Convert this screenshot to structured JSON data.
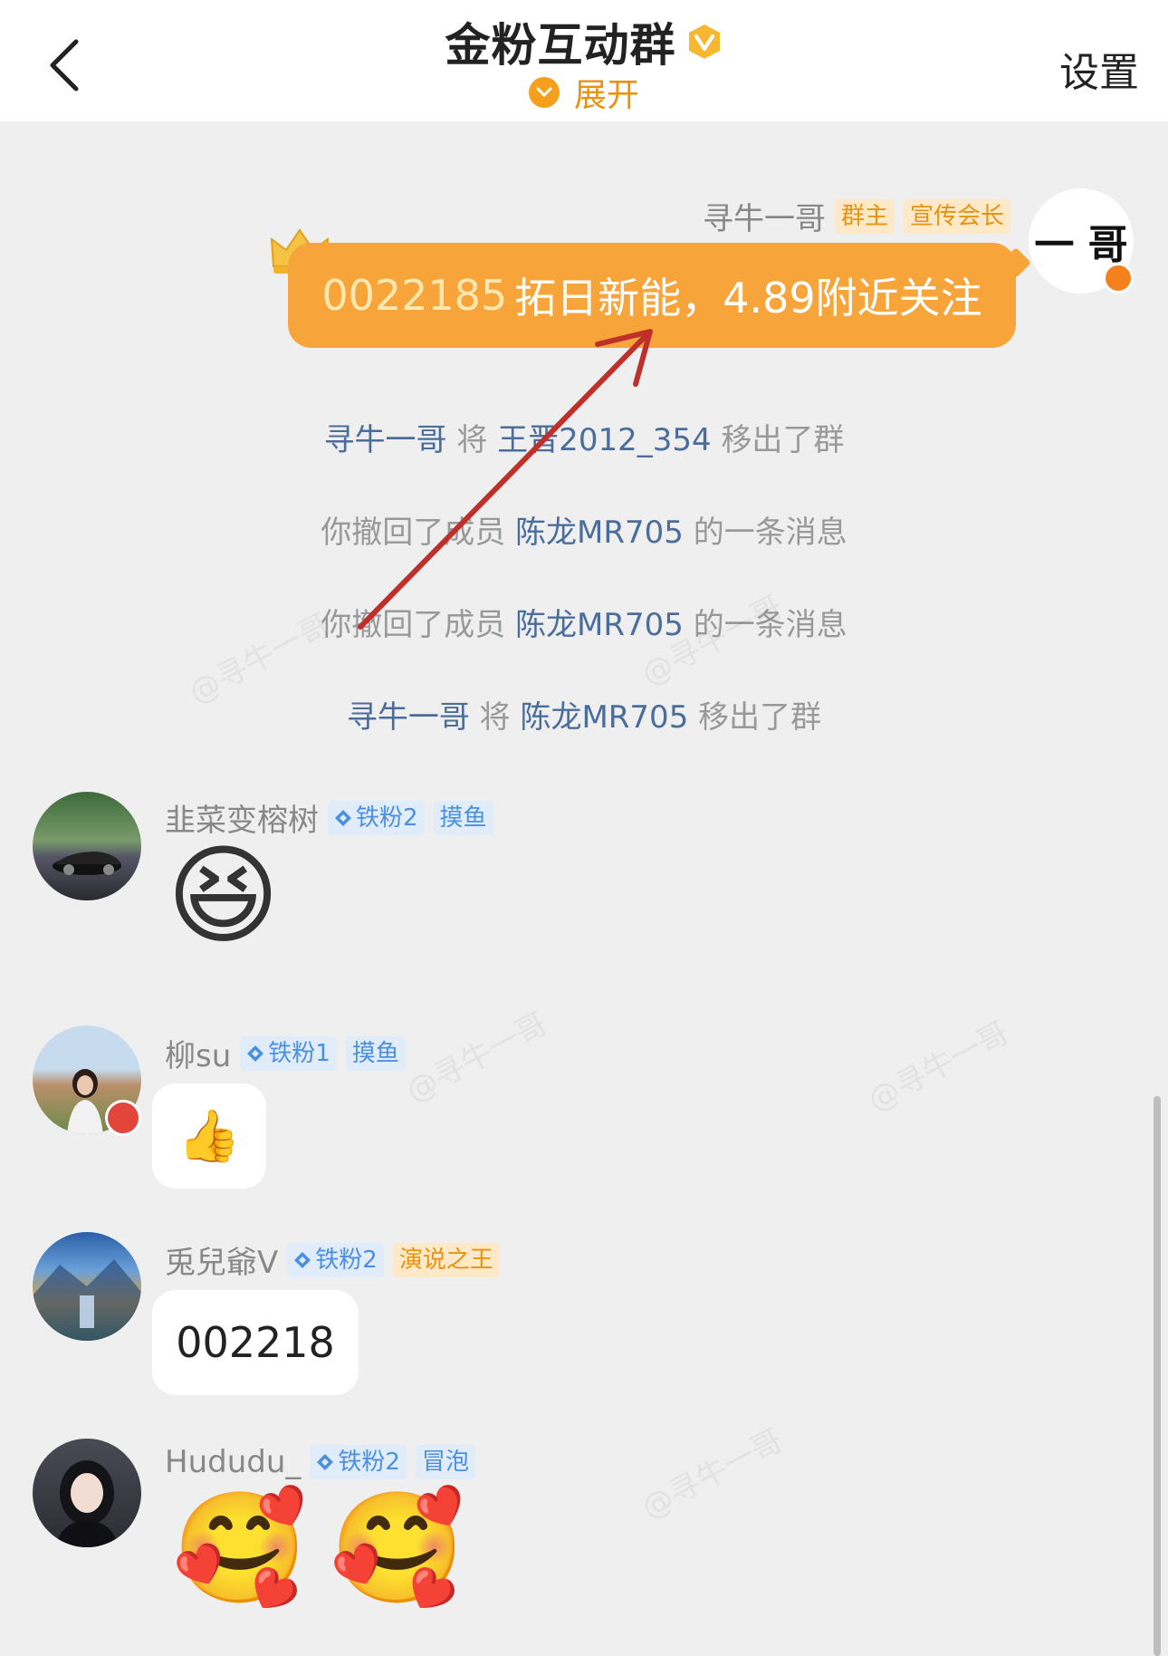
{
  "header": {
    "back_icon": "chevron-left-icon",
    "title": "金粉互动群",
    "title_badge_icon": "gold-v-badge-icon",
    "expand_label": "展开",
    "expand_icon": "chevron-down-circle-icon",
    "settings_label": "设置"
  },
  "owner_message": {
    "sender": "寻牛一哥",
    "tags": [
      "群主",
      "宣传会长"
    ],
    "avatar_text": "一 哥",
    "code": "0022185",
    "text": "拓日新能，4.89附近关注",
    "bubble_color": "#f7a43a"
  },
  "system_messages": [
    {
      "a": "寻牛一哥",
      "mid": "将",
      "b": "王晋2012_354",
      "end": "移出了群"
    },
    {
      "a": "你撤回了成员",
      "mid": "",
      "b": "陈龙MR705",
      "end": "的一条消息"
    },
    {
      "a": "你撤回了成员",
      "mid": "",
      "b": "陈龙MR705",
      "end": "的一条消息"
    },
    {
      "a": "寻牛一哥",
      "mid": "将",
      "b": "陈龙MR705",
      "end": "移出了群"
    }
  ],
  "messages": [
    {
      "sender": "韭菜变榕树",
      "fan_tag": "铁粉2",
      "role_tag": "摸鱼",
      "content_type": "emoji",
      "emoji": "😆"
    },
    {
      "sender": "柳su",
      "fan_tag": "铁粉1",
      "role_tag": "摸鱼",
      "content_type": "emoji-bubble",
      "emoji": "👍"
    },
    {
      "sender": "兎兒爺V",
      "fan_tag": "铁粉2",
      "role_tag": "演说之王",
      "content_type": "text",
      "text": "002218"
    },
    {
      "sender": "Hududu_",
      "fan_tag": "铁粉2",
      "role_tag": "冒泡",
      "content_type": "emoji",
      "emoji": "🥰"
    }
  ],
  "watermark_text": "@寻牛一哥",
  "colors": {
    "accent": "#f4a01e",
    "link": "#4a6d9c",
    "blue_tag": "#4b8fe0",
    "arrow": "#c0302a"
  }
}
